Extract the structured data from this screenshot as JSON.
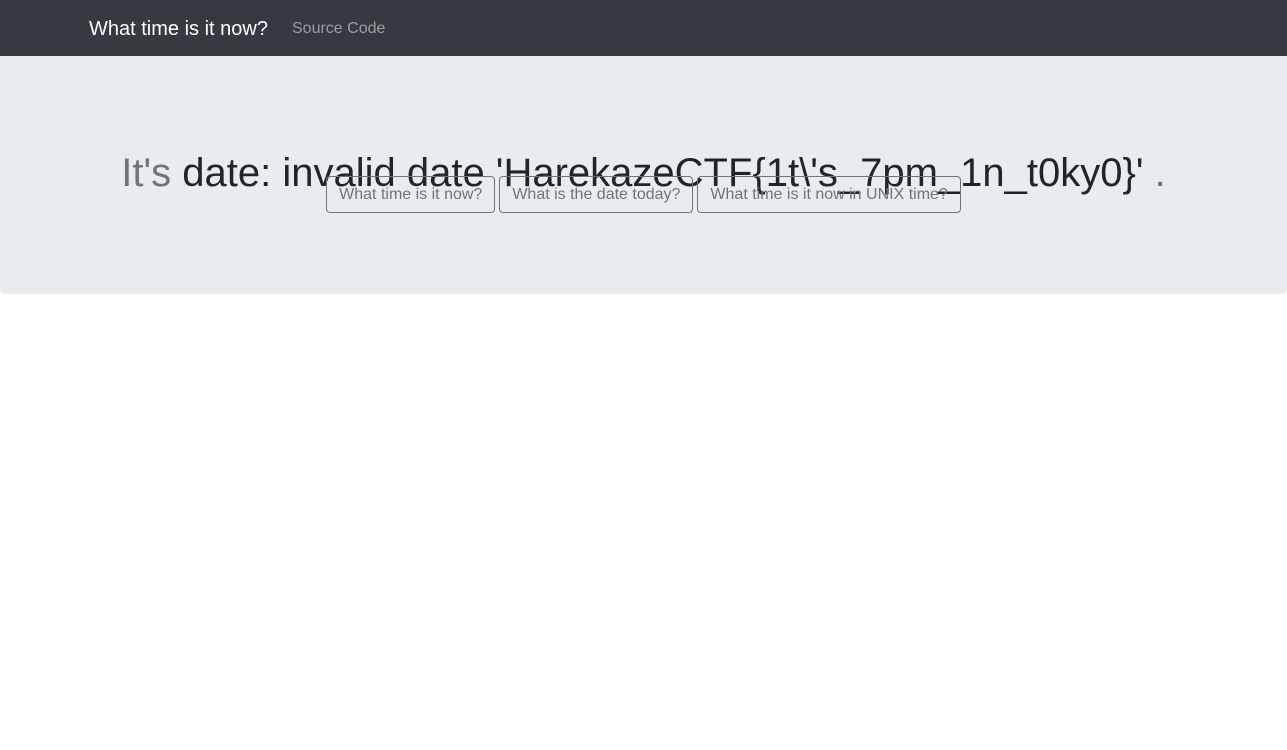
{
  "navbar": {
    "brand": "What time is it now?",
    "links": [
      {
        "label": "Source Code"
      }
    ]
  },
  "jumbotron": {
    "prefix": "It's",
    "result": "date: invalid date 'HarekazeCTF{1t\\'s_7pm_1n_t0ky0}'",
    "suffix": ".",
    "buttons": [
      {
        "label": "What time is it now?"
      },
      {
        "label": "What is the date today?"
      },
      {
        "label": "What time is it now in UNIX time?"
      }
    ]
  },
  "colors": {
    "navbar_bg": "#343a40",
    "jumbotron_bg": "#e9ecef",
    "muted_text": "#6c757d",
    "main_text": "#212529"
  }
}
